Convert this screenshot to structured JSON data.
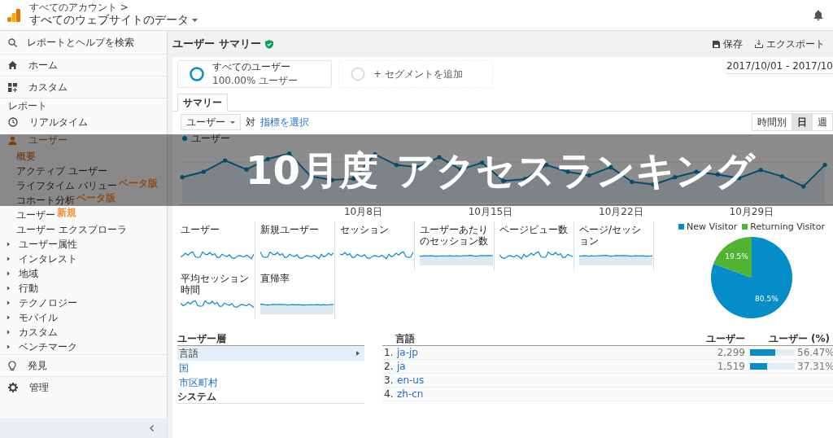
{
  "header": {
    "breadcrumb": "すべてのアカウント >",
    "title": "すべてのウェブサイトのデータ"
  },
  "sidebar": {
    "search": "レポートとヘルプを検索",
    "home": "ホーム",
    "custom": "カスタム",
    "section": "レポート",
    "realtime": "リアルタイム",
    "users": {
      "label": "ユーザー",
      "expanded": true,
      "children": [
        {
          "label": "概要",
          "selected": true
        },
        {
          "label": "アクティブ ユーザー",
          "selected": false
        },
        {
          "label": "ライフタイム バリュー",
          "badge": "ベータ版",
          "selected": false
        },
        {
          "label": "コホート分析",
          "badge": "ベータ版",
          "selected": false
        },
        {
          "label": "ユーザー",
          "badge": "新規",
          "selected": false
        },
        {
          "label": "ユーザー エクスプローラ",
          "selected": false
        }
      ]
    },
    "groups": [
      {
        "label": "ユーザー属性",
        "expanded": false
      },
      {
        "label": "インタレスト",
        "expanded": false
      },
      {
        "label": "地域",
        "expanded": false
      },
      {
        "label": "行動",
        "expanded": false
      },
      {
        "label": "テクノロジー",
        "expanded": false
      },
      {
        "label": "モバイル",
        "expanded": false
      },
      {
        "label": "カスタム",
        "expanded": false
      },
      {
        "label": "ベンチマーク",
        "expanded": false
      }
    ],
    "discover": "発見",
    "admin": "管理"
  },
  "main": {
    "title": "ユーザー サマリー",
    "save": "保存",
    "export": "エクスポート",
    "segment": {
      "label": "すべてのユーザー",
      "sub": "100.00% ユーザー"
    },
    "add_segment": "+ セグメントを追加",
    "date_range": "2017/10/01 - 2017/10",
    "tabs": [
      {
        "label": "サマリー",
        "selected": true
      }
    ],
    "metric_select": "ユーザー",
    "versus": "対",
    "choose_metric": "指標を選択",
    "granularity": [
      {
        "label": "時間別",
        "selected": false
      },
      {
        "label": "日",
        "selected": true
      },
      {
        "label": "週",
        "selected": false
      }
    ],
    "legend": "ユーザー",
    "x_labels": [
      "10月8日",
      "10月15日",
      "10月22日",
      "10月29日"
    ],
    "metrics": [
      {
        "label": "ユーザー",
        "kind": "line"
      },
      {
        "label": "新規ユーザー",
        "kind": "line"
      },
      {
        "label": "セッション",
        "kind": "line"
      },
      {
        "label": "ユーザーあたりのセッション数",
        "kind": "area"
      },
      {
        "label": "ページビュー数",
        "kind": "line"
      },
      {
        "label": "ページ/セッション",
        "kind": "area"
      },
      {
        "label": "平均セッション時間",
        "kind": "line"
      },
      {
        "label": "直帰率",
        "kind": "area"
      }
    ],
    "pie": {
      "legend": [
        {
          "color": "#058dc7"
        },
        {
          "color": "#50b432"
        }
      ],
      "chart_data": {
        "type": "pie",
        "legend": "top",
        "categories": [
          "New Visitor",
          "Returning Visitor"
        ],
        "values": [
          80.5,
          19.5
        ],
        "value_labels": [
          "80.5%",
          "19.5%"
        ]
      }
    }
  },
  "demographics": {
    "title": "ユーザー層",
    "items": [
      {
        "label": "言語",
        "selected": true
      },
      {
        "label": "国",
        "selected": false
      },
      {
        "label": "市区町村",
        "selected": false
      }
    ],
    "section": "システム"
  },
  "language_table": {
    "columns": [
      "言語",
      "ユーザー",
      "ユーザー (%)"
    ],
    "rows": [
      {
        "rank": "1.",
        "name": "ja-jp",
        "users": "2,299",
        "share": "56.47%",
        "level": 0.5647
      },
      {
        "rank": "2.",
        "name": "ja",
        "users": "1,519",
        "share": "37.31%",
        "level": 0.3731
      },
      {
        "rank": "3.",
        "name": "en-us"
      },
      {
        "rank": "4.",
        "name": "zh-cn"
      }
    ]
  },
  "banner": {
    "line_1": "10月度",
    "line_2": "アクセスランキング"
  }
}
